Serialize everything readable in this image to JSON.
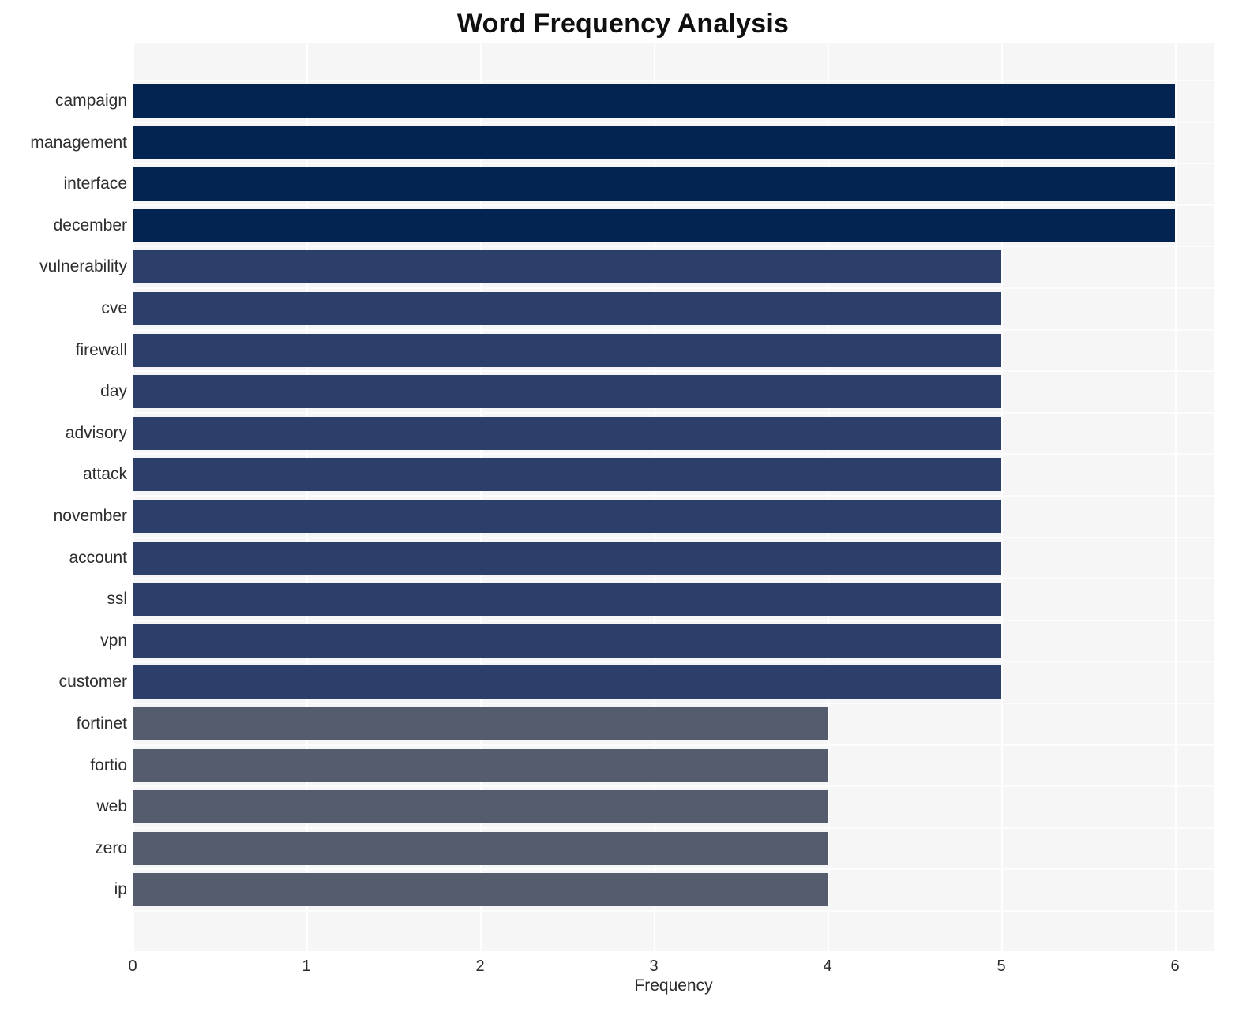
{
  "chart_data": {
    "type": "bar",
    "orientation": "horizontal",
    "title": "Word Frequency Analysis",
    "xlabel": "Frequency",
    "ylabel": "",
    "xlim": [
      0,
      6
    ],
    "xticks": [
      0,
      1,
      2,
      3,
      4,
      5,
      6
    ],
    "xtick_labels": [
      "0",
      "1",
      "2",
      "3",
      "4",
      "5",
      "6"
    ],
    "grid": true,
    "grid_color": "#ffffff",
    "plot_background": "#f6f6f7",
    "legend": null,
    "categories": [
      "campaign",
      "management",
      "interface",
      "december",
      "vulnerability",
      "cve",
      "firewall",
      "day",
      "advisory",
      "attack",
      "november",
      "account",
      "ssl",
      "vpn",
      "customer",
      "fortinet",
      "fortio",
      "web",
      "zero",
      "ip"
    ],
    "values": [
      6,
      6,
      6,
      6,
      5,
      5,
      5,
      5,
      5,
      5,
      5,
      5,
      5,
      5,
      5,
      4,
      4,
      4,
      4,
      4
    ],
    "bar_colors": [
      "#032350",
      "#032350",
      "#032350",
      "#032350",
      "#2c3f6b",
      "#2c3f6b",
      "#2c3f6b",
      "#2c3f6b",
      "#2c3f6b",
      "#2c3f6b",
      "#2c3f6b",
      "#2c3f6b",
      "#2c3f6b",
      "#2c3f6b",
      "#2c3f6b",
      "#555c6e",
      "#555c6e",
      "#555c6e",
      "#555c6e",
      "#555c6e"
    ],
    "palette": {
      "high": "#032350",
      "mid": "#2c3f6b",
      "low": "#555c6e"
    }
  }
}
